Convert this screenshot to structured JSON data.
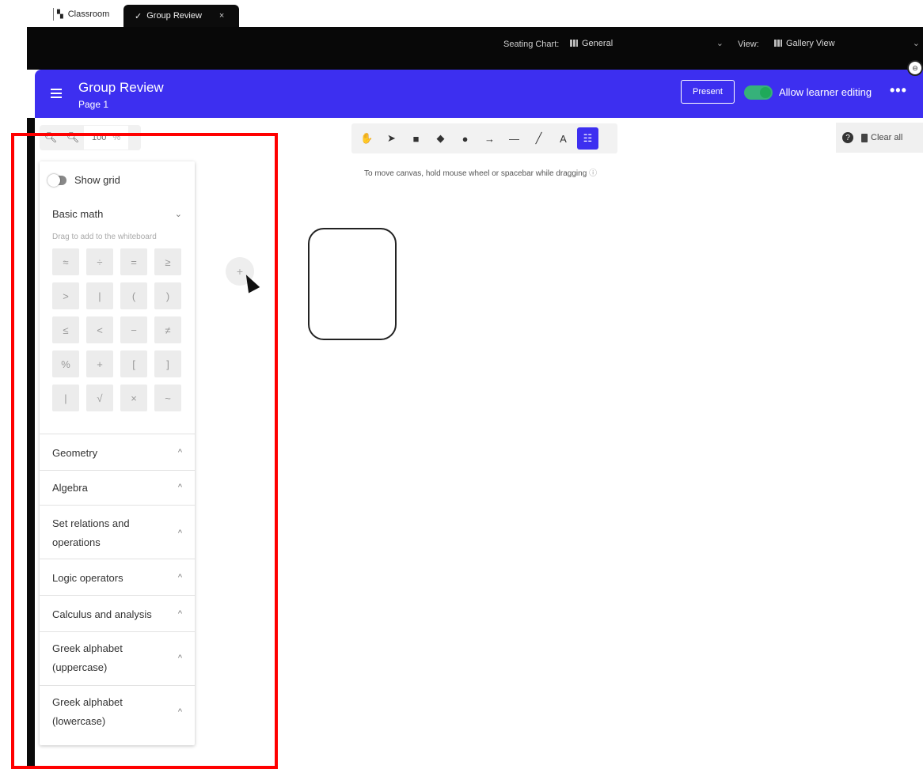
{
  "browser_tabs": {
    "classroom": "Classroom",
    "active": "Group Review",
    "close": "×"
  },
  "top_bar": {
    "seating_label": "Seating Chart:",
    "seating_value": "General",
    "view_label": "View:",
    "view_value": "Gallery View"
  },
  "header": {
    "title": "Group Review",
    "page": "Page 1",
    "present": "Present",
    "allow_editing": "Allow learner editing",
    "more": "•••"
  },
  "zoom": {
    "value": "100",
    "unit": "%"
  },
  "panel": {
    "show_grid": "Show grid",
    "basic_math": "Basic math",
    "drag_hint": "Drag to add to the whiteboard",
    "symbols": [
      "≈",
      "÷",
      "=",
      "≥",
      ">",
      "|",
      "(",
      ")",
      "≤",
      "<",
      "−",
      "≠",
      "%",
      "+",
      "[",
      "]",
      "|",
      "√",
      "×",
      "~"
    ],
    "sections": [
      "Geometry",
      "Algebra",
      "Set relations and operations",
      "Logic operators",
      "Calculus and analysis",
      "Greek alphabet (uppercase)",
      "Greek alphabet (lowercase)"
    ]
  },
  "tools": {
    "icons": [
      "hand-icon",
      "pointer-icon",
      "square-icon",
      "diamond-icon",
      "circle-icon",
      "arrow-icon",
      "line-icon",
      "pen-icon",
      "text-icon",
      "math-icon"
    ],
    "glyphs": [
      "✋",
      "➤",
      "■",
      "◆",
      "●",
      "→",
      "—",
      "╱",
      "A",
      "☷"
    ]
  },
  "hint": {
    "move": "To move canvas, hold mouse wheel or spacebar while dragging"
  },
  "right_tools": {
    "clear": "Clear all",
    "help": "?"
  },
  "floating": {
    "plus": "+"
  },
  "colors": {
    "brand": "#3d2ff0",
    "toggle_on": "#36b17a",
    "annotation": "#ff0000"
  }
}
